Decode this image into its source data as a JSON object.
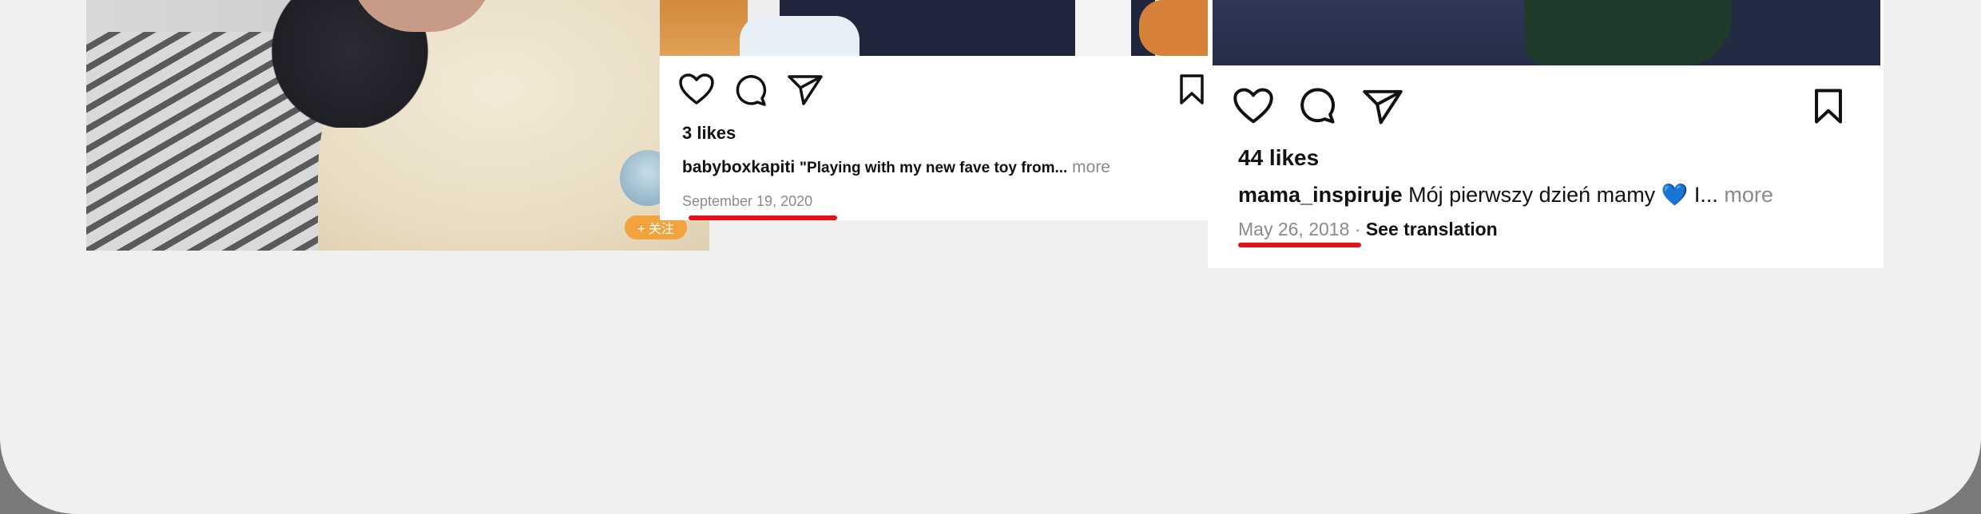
{
  "left_post": {
    "follow_label": "+ 关注"
  },
  "middle_post": {
    "likes": "3 likes",
    "username": "babyboxkapiti",
    "caption": "\"Playing with my new fave toy from...",
    "more": "more",
    "date": "September 19, 2020",
    "icons": [
      "heart-icon",
      "comment-icon",
      "share-icon",
      "bookmark-icon"
    ]
  },
  "right_post": {
    "likes": "44 likes",
    "username": "mama_inspiruje",
    "caption_before_emoji": "Mój pierwszy dzień mamy",
    "emoji": "💙",
    "caption_after_emoji": "I...",
    "more": "more",
    "date": "May 26, 2018",
    "separator": "·",
    "see_translation": "See translation",
    "icons": [
      "heart-icon",
      "comment-icon",
      "share-icon",
      "bookmark-icon"
    ]
  },
  "colors": {
    "underline": "#e31218",
    "follow_pill": "#f3a33c",
    "background": "#f0f0f0"
  }
}
